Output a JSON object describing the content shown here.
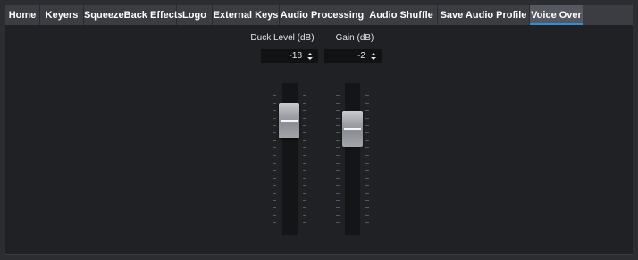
{
  "tabs": [
    {
      "label": "Home",
      "active": false
    },
    {
      "label": "Keyers",
      "active": false
    },
    {
      "label": "SqueezeBack Effects",
      "active": false
    },
    {
      "label": "Logo",
      "active": false
    },
    {
      "label": "External Keys",
      "active": false
    },
    {
      "label": "Audio Processing",
      "active": false
    },
    {
      "label": "Audio Shuffle",
      "active": false
    },
    {
      "label": "Save Audio Profile",
      "active": false
    },
    {
      "label": "Voice Over",
      "active": true
    }
  ],
  "faders": [
    {
      "label": "Duck Level (dB)",
      "value": "-18"
    },
    {
      "label": "Gain (dB)",
      "value": "-2"
    }
  ],
  "colors": {
    "accent": "#2f8fdc",
    "tab_bg": "#3b3d43",
    "panel_bg": "#1f2124"
  },
  "icons": {
    "spinner": "up-down-arrows-icon"
  }
}
